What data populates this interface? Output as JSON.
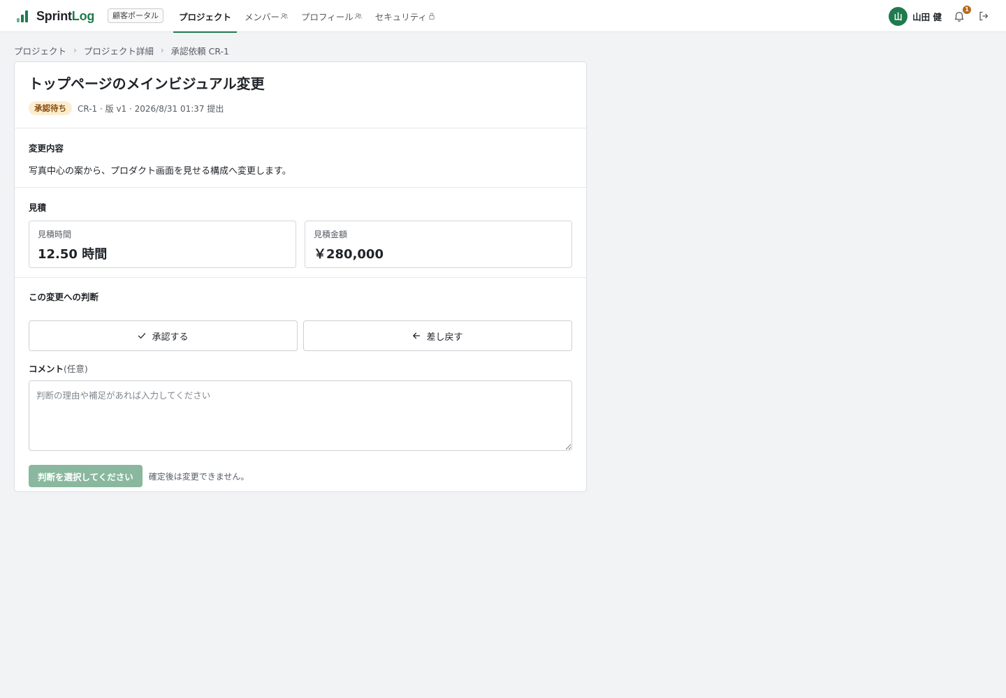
{
  "app": {
    "brand_main": "Sprint",
    "brand_accent": "Log",
    "portal_badge": "顧客ポータル"
  },
  "nav": {
    "items": [
      {
        "label": "プロジェクト",
        "active": true,
        "icon": ""
      },
      {
        "label": "メンバー",
        "active": false,
        "icon": "users-icon"
      },
      {
        "label": "プロフィール",
        "active": false,
        "icon": "users-icon"
      },
      {
        "label": "セキュリティ",
        "active": false,
        "icon": "lock-icon"
      }
    ]
  },
  "user": {
    "avatar_initial": "山",
    "name": "山田 健",
    "notification_count": "1"
  },
  "breadcrumb": {
    "items": [
      "プロジェクト",
      "プロジェクト詳細",
      "承認依頼 CR-1"
    ],
    "separator": "›"
  },
  "request": {
    "title": "トップページのメインビジュアル変更",
    "status": "承認待ち",
    "meta": "CR-1 · 版 v1 · 2026/8/31 01:37 提出"
  },
  "change": {
    "label": "変更内容",
    "text": "写真中心の案から、プロダクト画面を見せる構成へ変更します。"
  },
  "estimate": {
    "label": "見積",
    "hours_label": "見積時間",
    "hours_value": "12.50 時間",
    "amount_label": "見積金額",
    "amount_value": "￥280,000"
  },
  "decision": {
    "label": "この変更への判断",
    "approve_label": "承認する",
    "reject_label": "差し戻す",
    "comment_label": "コメント",
    "comment_optional": "(任意)",
    "comment_placeholder": "判断の理由や補足があれば入力してください",
    "submit_label": "判断を選択してください",
    "submit_note": "確定後は変更できません。"
  },
  "colors": {
    "brand": "#1f7a4d",
    "status_bg": "#fbedcf",
    "status_text": "#8a4d10",
    "submit_disabled": "#89b89e",
    "notification": "#b56a1c"
  }
}
